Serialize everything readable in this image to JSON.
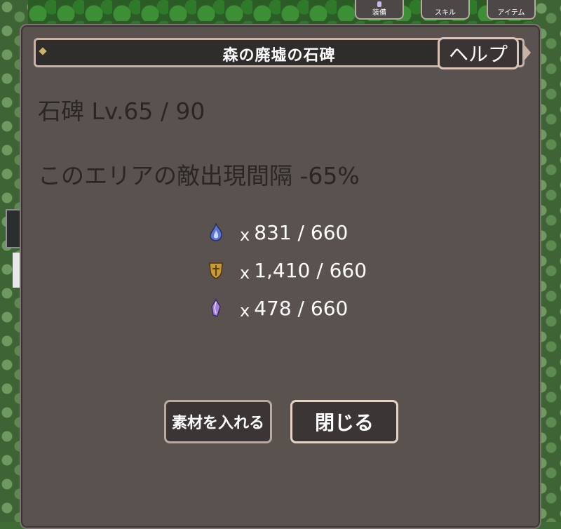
{
  "top_menu": {
    "equip_label": "装備",
    "skill_label": "スキル",
    "item_label": "アイテム"
  },
  "dialog": {
    "title": "森の廃墟の石碑",
    "help_label": "ヘルプ",
    "level_text": "石碑 Lv.65 / 90",
    "effect_text": "このエリアの敵出現間隔 -65%",
    "materials": [
      {
        "icon": "blue-flame-icon",
        "prefix": "x",
        "amount": "831 / 660"
      },
      {
        "icon": "gold-shield-icon",
        "prefix": "x",
        "amount": "1,410 / 660"
      },
      {
        "icon": "purple-crystal-icon",
        "prefix": "x",
        "amount": "478 / 660"
      }
    ],
    "insert_button_label": "素材を入れる",
    "close_button_label": "閉じる"
  },
  "colors": {
    "dialog_bg": "#59524f",
    "title_bar_bg": "#2f2c2c",
    "frame_accent": "#c9b2a5",
    "text_dark": "#2a2626",
    "text_light": "#ffffff"
  }
}
